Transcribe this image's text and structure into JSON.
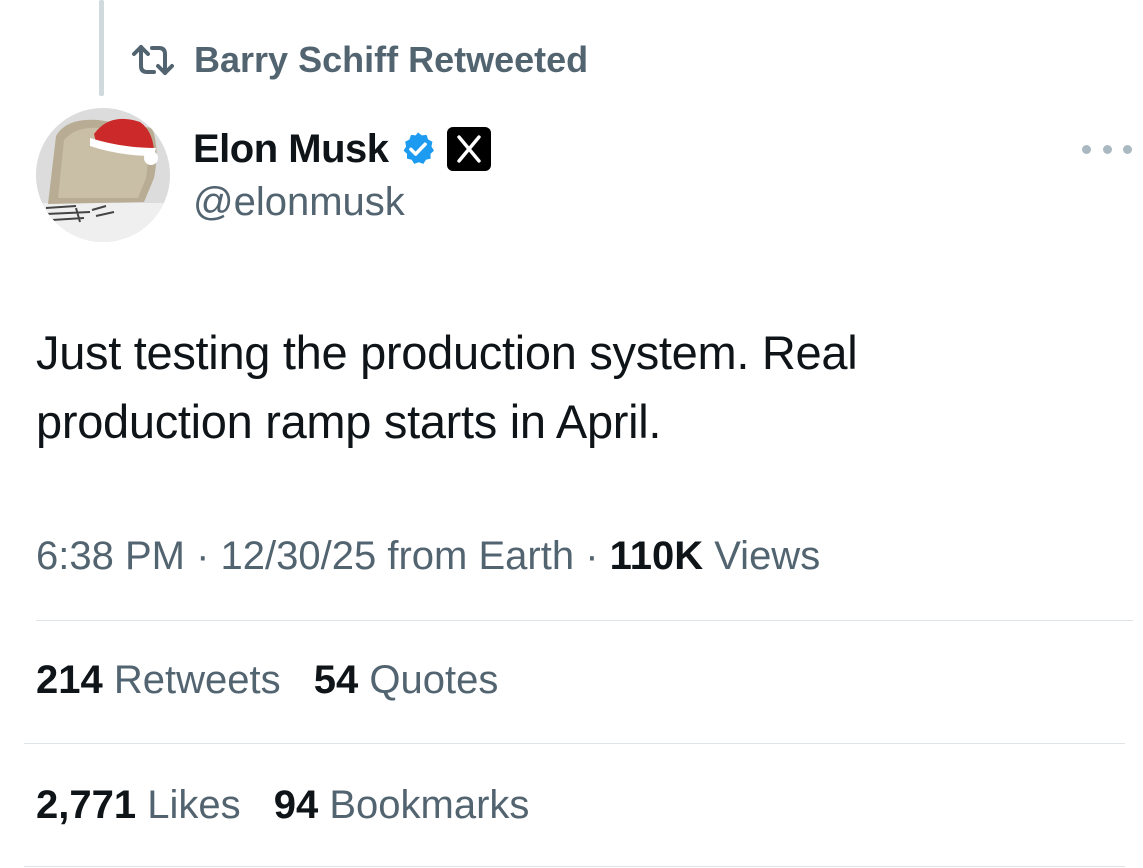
{
  "retweet_context": {
    "icon": "retweet-icon",
    "text": "Barry Schiff Retweeted"
  },
  "author": {
    "display_name": "Elon Musk",
    "handle": "@elonmusk",
    "verified_badge_icon": "verified-badge-icon",
    "affiliate_badge_icon": "x-logo-icon",
    "verified_color": "#1d9bf0"
  },
  "more_menu": {
    "icon": "more-options-icon"
  },
  "tweet": {
    "text_line_1": "Just testing the production system. Real",
    "text_line_2": "production ramp starts in April."
  },
  "meta": {
    "time": "6:38 PM",
    "separator": "·",
    "date": "12/30/25",
    "source": "from Earth",
    "views_count": "110K",
    "views_label": "Views"
  },
  "stats": {
    "retweets_count": "214",
    "retweets_label": "Retweets",
    "quotes_count": "54",
    "quotes_label": "Quotes",
    "likes_count": "2,771",
    "likes_label": "Likes",
    "bookmarks_count": "94",
    "bookmarks_label": "Bookmarks"
  },
  "colors": {
    "text_primary": "#0f1419",
    "text_secondary": "#536471",
    "divider": "#dfe4e8",
    "thread_line": "#cfd9de"
  }
}
